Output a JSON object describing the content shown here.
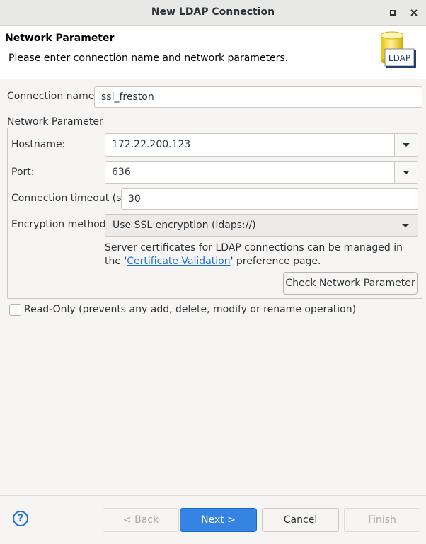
{
  "window": {
    "title": "New LDAP Connection"
  },
  "header": {
    "title": "Network Parameter",
    "description": "Please enter connection name and network parameters.",
    "logo_text": "LDAP"
  },
  "form": {
    "connection_name_label": "Connection name:",
    "connection_name_value": "ssl_freston",
    "group_legend": "Network Parameter",
    "hostname_label": "Hostname:",
    "hostname_value": "172.22.200.123",
    "port_label": "Port:",
    "port_value": "636",
    "timeout_label": "Connection timeout (s):",
    "timeout_value": "30",
    "encryption_label": "Encryption method:",
    "encryption_value": "Use SSL encryption (ldaps://)",
    "info_prefix": "Server certificates for LDAP connections can be managed in the '",
    "info_link": "Certificate Validation",
    "info_suffix": "' preference page.",
    "check_button": "Check Network Parameter",
    "readonly_label": "Read-Only (prevents any add, delete, modify or rename operation)",
    "readonly_checked": false
  },
  "footer": {
    "help_icon": "?",
    "back_button": "< Back",
    "next_button": "Next >",
    "cancel_button": "Cancel",
    "finish_button": "Finish"
  },
  "colors": {
    "accent": "#3584e4",
    "link": "#1c71d8"
  }
}
